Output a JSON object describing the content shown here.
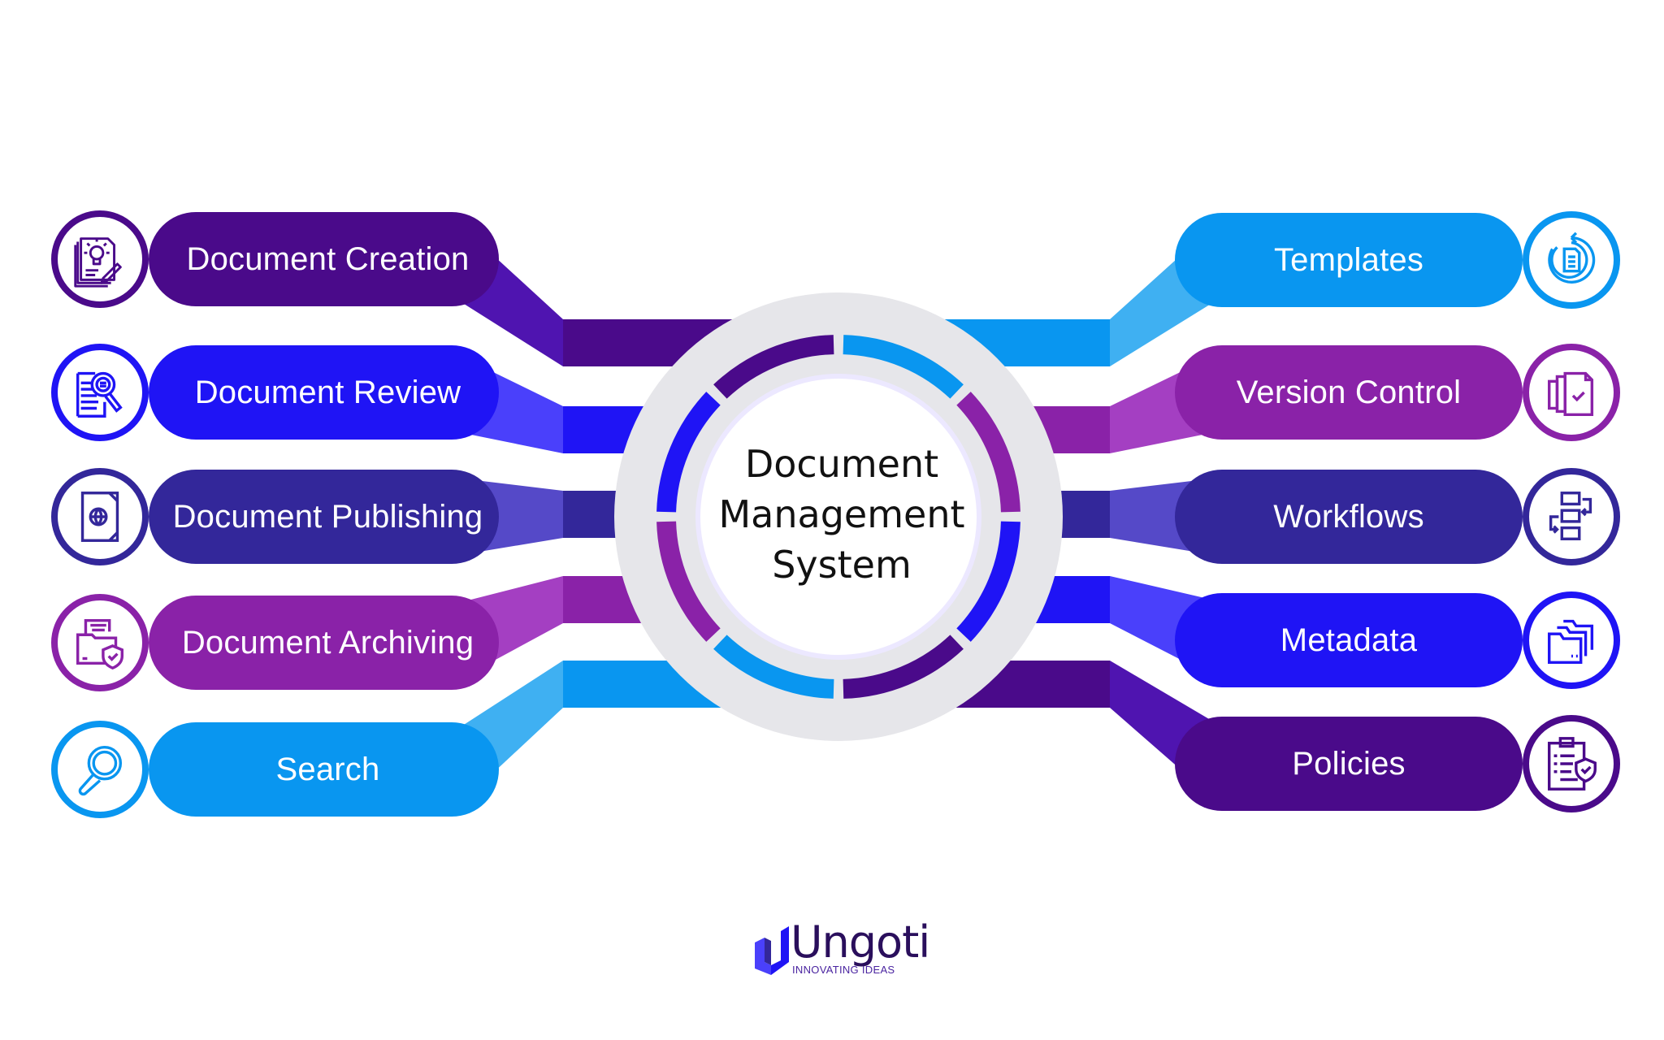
{
  "center": {
    "title_lines": [
      "Document",
      "Management",
      "System"
    ]
  },
  "colors": {
    "dark_purple": "#4a0a8a",
    "dark_purple_light": "#4f14b0",
    "blue": "#1f14f5",
    "blue_light": "#4a40fb",
    "indigo": "#33279a",
    "indigo_light": "#5549c8",
    "purple": "#8a22a8",
    "purple_light": "#a43fc2",
    "sky": "#0996f0",
    "sky_light": "#3fb0f2",
    "ring_grey": "#e6e6ea"
  },
  "left_items": [
    {
      "label": "Document Creation",
      "icon": "document-lightbulb-pencil-icon",
      "color": "dark_purple"
    },
    {
      "label": "Document Review",
      "icon": "document-magnifier-icon",
      "color": "blue"
    },
    {
      "label": "Document Publishing",
      "icon": "document-globe-icon",
      "color": "indigo"
    },
    {
      "label": "Document Archiving",
      "icon": "folder-shield-icon",
      "color": "purple"
    },
    {
      "label": "Search",
      "icon": "magnifying-glass-icon",
      "color": "sky"
    }
  ],
  "right_items": [
    {
      "label": "Templates",
      "icon": "document-refresh-icon",
      "color": "sky"
    },
    {
      "label": "Version Control",
      "icon": "stacked-documents-check-icon",
      "color": "purple"
    },
    {
      "label": "Workflows",
      "icon": "workflow-boxes-arrows-icon",
      "color": "indigo"
    },
    {
      "label": "Metadata",
      "icon": "stacked-folders-icon",
      "color": "blue"
    },
    {
      "label": "Policies",
      "icon": "clipboard-shield-icon",
      "color": "dark_purple"
    }
  ],
  "ring_segments": [
    "dark_purple",
    "sky",
    "purple",
    "blue",
    "dark_purple",
    "sky",
    "purple",
    "blue"
  ],
  "logo": {
    "name": "Ungoti",
    "tagline": "INNOVATING IDEAS"
  }
}
